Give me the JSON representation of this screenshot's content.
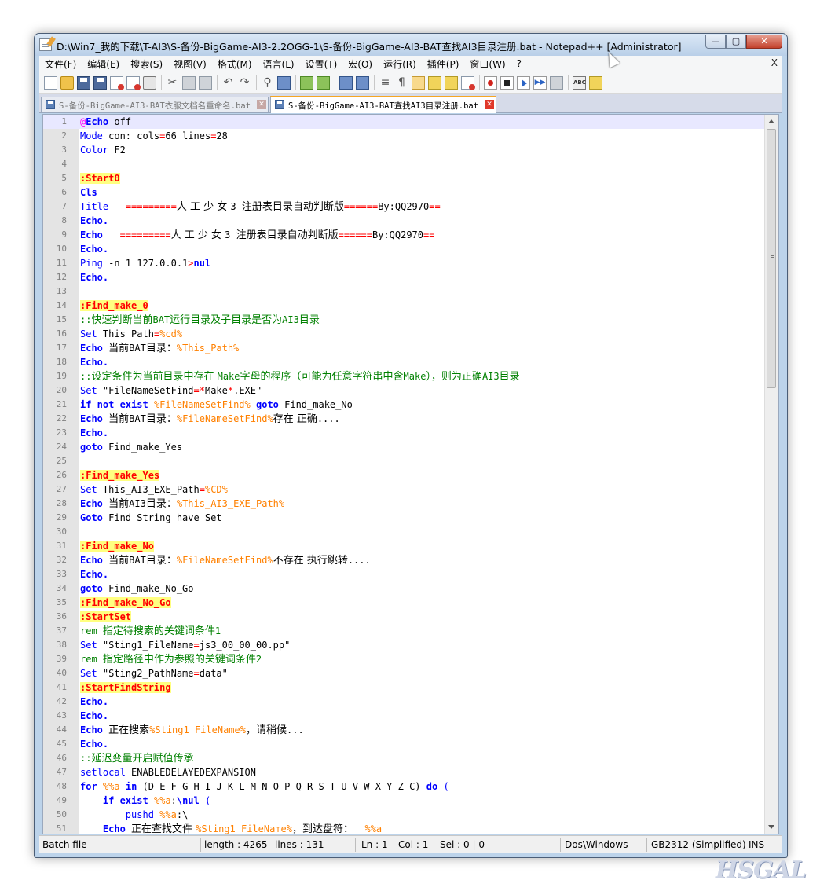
{
  "window": {
    "title": "D:\\Win7_我的下载\\T-AI3\\S-备份-BigGame-AI3-2.2OGG-1\\S-备份-BigGame-AI3-BAT查找AI3目录注册.bat - Notepad++ [Administrator]",
    "buttons": {
      "minimize": "—",
      "maximize": "▢",
      "close": "✕"
    }
  },
  "menu": [
    "文件(F)",
    "编辑(E)",
    "搜索(S)",
    "视图(V)",
    "格式(M)",
    "语言(L)",
    "设置(T)",
    "宏(O)",
    "运行(R)",
    "插件(P)",
    "窗口(W)",
    "?"
  ],
  "menu_close": "X",
  "tabs": [
    {
      "label": "S-备份-BigGame-AI3-BAT衣服文档名重命名.bat",
      "active": false
    },
    {
      "label": "S-备份-BigGame-AI3-BAT查找AI3目录注册.bat",
      "active": true
    }
  ],
  "lines": [
    [
      [
        "at",
        "@"
      ],
      [
        "kwb",
        "Echo"
      ],
      [
        "txtc",
        " off"
      ]
    ],
    [
      [
        "kw",
        "Mode"
      ],
      [
        "txtc",
        " con: cols"
      ],
      [
        "op",
        "="
      ],
      [
        "txtc",
        "66 lines"
      ],
      [
        "op",
        "="
      ],
      [
        "txtc",
        "28"
      ]
    ],
    [
      [
        "kw",
        "Color"
      ],
      [
        "txtc",
        " F2"
      ]
    ],
    [],
    [
      [
        "lbl",
        ":Start0"
      ]
    ],
    [
      [
        "kwb",
        "Cls"
      ]
    ],
    [
      [
        "kw",
        "Title"
      ],
      [
        "txtc",
        "   "
      ],
      [
        "op",
        "========="
      ],
      [
        "cjk",
        "人 工 少 女 "
      ],
      [
        "txtc",
        "3 "
      ],
      [
        "cjk",
        "注册表目录自动判断版"
      ],
      [
        "op",
        "======"
      ],
      [
        "txtc",
        "By:QQ2970"
      ],
      [
        "op",
        "=="
      ]
    ],
    [
      [
        "kwb",
        "Echo."
      ]
    ],
    [
      [
        "kwb",
        "Echo"
      ],
      [
        "txtc",
        "   "
      ],
      [
        "op",
        "========="
      ],
      [
        "cjk",
        "人 工 少 女 "
      ],
      [
        "txtc",
        "3 "
      ],
      [
        "cjk",
        "注册表目录自动判断版"
      ],
      [
        "op",
        "======"
      ],
      [
        "txtc",
        "By:QQ2970"
      ],
      [
        "op",
        "=="
      ]
    ],
    [
      [
        "kwb",
        "Echo."
      ]
    ],
    [
      [
        "kw",
        "Ping"
      ],
      [
        "txtc",
        " -n 1 127.0.0.1"
      ],
      [
        "op",
        ">"
      ],
      [
        "kwb",
        "nul"
      ]
    ],
    [
      [
        "kwb",
        "Echo."
      ]
    ],
    [],
    [
      [
        "lbl",
        ":Find_make_0"
      ]
    ],
    [
      [
        "cmt",
        "::"
      ],
      [
        "cmt cjk",
        "快速判断当前"
      ],
      [
        "cmt",
        "BAT"
      ],
      [
        "cmt cjk",
        "运行目录及子目录是否为"
      ],
      [
        "cmt",
        "AI3"
      ],
      [
        "cmt cjk",
        "目录"
      ]
    ],
    [
      [
        "kw",
        "Set"
      ],
      [
        "txtc",
        " This_Path"
      ],
      [
        "op",
        "="
      ],
      [
        "var",
        "%cd%"
      ]
    ],
    [
      [
        "kwb",
        "Echo"
      ],
      [
        "txtc",
        " "
      ],
      [
        "cjk",
        "当前"
      ],
      [
        "txtc",
        "BAT"
      ],
      [
        "cjk",
        "目录："
      ],
      [
        "var",
        "%This_Path%"
      ]
    ],
    [
      [
        "kwb",
        "Echo."
      ]
    ],
    [
      [
        "cmt",
        "::"
      ],
      [
        "cmt cjk",
        "设定条件为当前目录中存在 "
      ],
      [
        "cmt",
        "Make"
      ],
      [
        "cmt cjk",
        "字母的程序（可能为任意字符串中含"
      ],
      [
        "cmt",
        "Make"
      ],
      [
        "cmt cjk",
        "），则为正确"
      ],
      [
        "cmt",
        "AI3"
      ],
      [
        "cmt cjk",
        "目录"
      ]
    ],
    [
      [
        "kw",
        "Set"
      ],
      [
        "txtc",
        " \"FileNameSetFind"
      ],
      [
        "op",
        "=*"
      ],
      [
        "txtc",
        "Make"
      ],
      [
        "op",
        "*"
      ],
      [
        "txtc",
        ".EXE\""
      ]
    ],
    [
      [
        "kwb",
        "if not exist"
      ],
      [
        "txtc",
        " "
      ],
      [
        "var",
        "%FileNameSetFind%"
      ],
      [
        "txtc",
        " "
      ],
      [
        "kwb",
        "goto"
      ],
      [
        "txtc",
        " Find_make_No"
      ]
    ],
    [
      [
        "kwb",
        "Echo"
      ],
      [
        "txtc",
        " "
      ],
      [
        "cjk",
        "当前"
      ],
      [
        "txtc",
        "BAT"
      ],
      [
        "cjk",
        "目录："
      ],
      [
        "var",
        "%FileNameSetFind%"
      ],
      [
        "cjk",
        "存在 正确"
      ],
      [
        "txtc",
        "...."
      ]
    ],
    [
      [
        "kwb",
        "Echo."
      ]
    ],
    [
      [
        "kwb",
        "goto"
      ],
      [
        "txtc",
        " Find_make_Yes"
      ]
    ],
    [],
    [
      [
        "lbl",
        ":Find_make_Yes"
      ]
    ],
    [
      [
        "kw",
        "Set"
      ],
      [
        "txtc",
        " This_AI3_EXE_Path"
      ],
      [
        "op",
        "="
      ],
      [
        "var",
        "%CD%"
      ]
    ],
    [
      [
        "kwb",
        "Echo"
      ],
      [
        "txtc",
        " "
      ],
      [
        "cjk",
        "当前"
      ],
      [
        "txtc",
        "AI3"
      ],
      [
        "cjk",
        "目录："
      ],
      [
        "var",
        "%This_AI3_EXE_Path%"
      ]
    ],
    [
      [
        "kwb",
        "Goto"
      ],
      [
        "txtc",
        " Find_String_have_Set"
      ]
    ],
    [],
    [
      [
        "lbl",
        ":Find_make_No"
      ]
    ],
    [
      [
        "kwb",
        "Echo"
      ],
      [
        "txtc",
        " "
      ],
      [
        "cjk",
        "当前"
      ],
      [
        "txtc",
        "BAT"
      ],
      [
        "cjk",
        "目录："
      ],
      [
        "var",
        "%FileNameSetFind%"
      ],
      [
        "cjk",
        "不存在 执行跳转"
      ],
      [
        "txtc",
        "...."
      ]
    ],
    [
      [
        "kwb",
        "Echo."
      ]
    ],
    [
      [
        "kwb",
        "goto"
      ],
      [
        "txtc",
        " Find_make_No_Go"
      ]
    ],
    [
      [
        "lbl",
        ":Find_make_No_Go"
      ]
    ],
    [
      [
        "lbl",
        ":StartSet"
      ]
    ],
    [
      [
        "cmt",
        "rem "
      ],
      [
        "cmt cjk",
        "指定待搜索的关键词条件"
      ],
      [
        "cmt",
        "1"
      ]
    ],
    [
      [
        "kw",
        "Set"
      ],
      [
        "txtc",
        " \"Sting1_FileName"
      ],
      [
        "op",
        "="
      ],
      [
        "txtc",
        "js3_00_00_00.pp\""
      ]
    ],
    [
      [
        "cmt",
        "rem "
      ],
      [
        "cmt cjk",
        "指定路径中作为参照的关键词条件"
      ],
      [
        "cmt",
        "2"
      ]
    ],
    [
      [
        "kw",
        "Set"
      ],
      [
        "txtc",
        " \"Sting2_PathName"
      ],
      [
        "op",
        "="
      ],
      [
        "txtc",
        "data\""
      ]
    ],
    [
      [
        "lbl",
        ":StartFindString"
      ]
    ],
    [
      [
        "kwb",
        "Echo."
      ]
    ],
    [
      [
        "kwb",
        "Echo."
      ]
    ],
    [
      [
        "kwb",
        "Echo"
      ],
      [
        "txtc",
        " "
      ],
      [
        "cjk",
        "正在搜索"
      ],
      [
        "var",
        "%Sting1_FileName%"
      ],
      [
        "cjk",
        "，请稍候"
      ],
      [
        "txtc",
        "..."
      ]
    ],
    [
      [
        "kwb",
        "Echo."
      ]
    ],
    [
      [
        "cmt",
        "::"
      ],
      [
        "cmt cjk",
        "延迟变量开启赋值传承"
      ]
    ],
    [
      [
        "kw",
        "setlocal"
      ],
      [
        "txtc",
        " ENABLEDELAYEDEXPANSION"
      ]
    ],
    [
      [
        "kwb",
        "for"
      ],
      [
        "txtc",
        " "
      ],
      [
        "var",
        "%%a"
      ],
      [
        "txtc",
        " "
      ],
      [
        "kwb",
        "in"
      ],
      [
        "txtc",
        " (D E F G H I J K L M N O P Q R S T U V W X Y Z C) "
      ],
      [
        "kwb",
        "do"
      ],
      [
        "txtc",
        " "
      ],
      [
        "kw",
        "("
      ]
    ],
    [
      [
        "txtc",
        "    "
      ],
      [
        "kwb",
        "if exist"
      ],
      [
        "txtc",
        " "
      ],
      [
        "var",
        "%%a"
      ],
      [
        "txtc",
        ":"
      ],
      [
        "kwb",
        "\\nul"
      ],
      [
        "txtc",
        " "
      ],
      [
        "kw",
        "("
      ]
    ],
    [
      [
        "txtc",
        "        "
      ],
      [
        "kw",
        "pushd"
      ],
      [
        "txtc",
        " "
      ],
      [
        "var",
        "%%a"
      ],
      [
        "txtc",
        ":\\"
      ]
    ],
    [
      [
        "txtc",
        "    "
      ],
      [
        "kwb",
        "Echo"
      ],
      [
        "txtc",
        " "
      ],
      [
        "cjk",
        "正在查找文件 "
      ],
      [
        "var",
        "%Sting1_FileName%"
      ],
      [
        "cjk",
        "，到达盘符："
      ],
      [
        "txtc",
        "  "
      ],
      [
        "var",
        "%%a"
      ]
    ]
  ],
  "status": {
    "type": "Batch file",
    "length": "length : 4265",
    "lines": "lines : 131",
    "ln": "Ln : 1",
    "col": "Col : 1",
    "sel": "Sel : 0 | 0",
    "eol": "Dos\\Windows",
    "encoding": "GB2312 (Simplified)",
    "mode": "INS"
  },
  "watermark": "HSGAL"
}
